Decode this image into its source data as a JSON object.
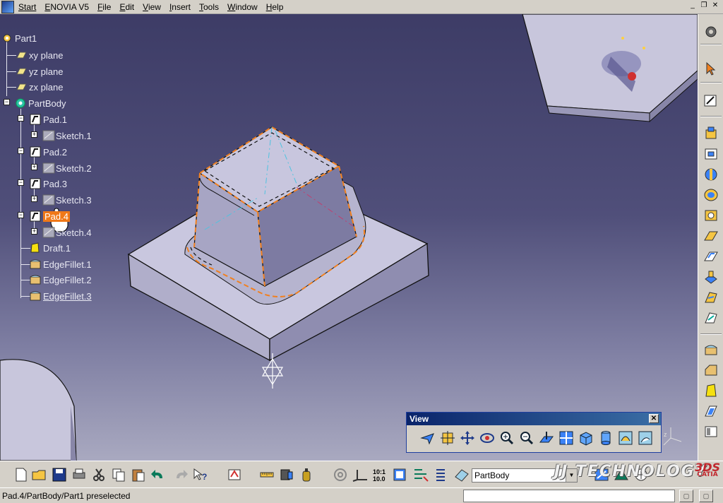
{
  "menubar": {
    "items": [
      "Start",
      "ENOVIA V5",
      "File",
      "Edit",
      "View",
      "Insert",
      "Tools",
      "Window",
      "Help"
    ]
  },
  "tree": {
    "root": "Part1",
    "items": [
      {
        "label": "xy plane",
        "icon": "plane-icon"
      },
      {
        "label": "yz plane",
        "icon": "plane-icon"
      },
      {
        "label": "zx plane",
        "icon": "plane-icon"
      },
      {
        "label": "PartBody",
        "icon": "body-gear-icon"
      },
      {
        "label": "Pad.1",
        "icon": "pad-icon"
      },
      {
        "label": "Sketch.1",
        "icon": "sketch-icon"
      },
      {
        "label": "Pad.2",
        "icon": "pad-icon"
      },
      {
        "label": "Sketch.2",
        "icon": "sketch-icon"
      },
      {
        "label": "Pad.3",
        "icon": "pad-icon"
      },
      {
        "label": "Sketch.3",
        "icon": "sketch-icon"
      },
      {
        "label": "Pad.4",
        "icon": "pad-icon"
      },
      {
        "label": "Sketch.4",
        "icon": "sketch-icon"
      },
      {
        "label": "Draft.1",
        "icon": "draft-icon"
      },
      {
        "label": "EdgeFillet.1",
        "icon": "edgefillet-icon"
      },
      {
        "label": "EdgeFillet.2",
        "icon": "edgefillet-icon"
      },
      {
        "label": "EdgeFillet.3",
        "icon": "edgefillet-icon"
      }
    ],
    "highlighted": "Pad.4"
  },
  "view_toolbar": {
    "title": "View",
    "close": "✕",
    "buttons": [
      "fly-mode-icon",
      "fit-all-icon",
      "pan-icon",
      "rotate-icon",
      "zoom-in-icon",
      "zoom-out-icon",
      "normal-view-icon",
      "multi-view-icon",
      "iso-view-icon",
      "shading-icon",
      "hide-show-icon",
      "swap-visible-icon"
    ]
  },
  "right_toolbar": {
    "buttons": [
      "compass-icon",
      "select-arrow-icon",
      "sketcher-icon",
      "pad-icon",
      "pocket-icon",
      "shaft-icon",
      "groove-icon",
      "hole-icon",
      "rib-icon",
      "slot-icon",
      "stiffener-icon",
      "loft-icon",
      "remove-loft-icon",
      "edge-fillet-icon",
      "chamfer-icon",
      "draft-icon",
      "shell-icon",
      "thickness-icon"
    ]
  },
  "bottom_toolbar": {
    "buttons": [
      "new-icon",
      "open-icon",
      "save-icon",
      "print-icon",
      "cut-icon",
      "copy-icon",
      "paste-icon",
      "undo-icon",
      "redo-icon",
      "whats-this-icon",
      "update-icon",
      "measure-icon",
      "tools-icon",
      "mass-icon",
      "spin-icon",
      "axis-icon",
      "snap-grid-icon",
      "work-plane-icon",
      "constraint-icon",
      "layer-icon",
      "geometry-icon"
    ],
    "current_body": "PartBody",
    "watermark": "JJ TECHNOLOGY",
    "brand": "CATIA",
    "brand_mark": "3DS"
  },
  "status": {
    "text": "Pad.4/PartBody/Part1 preselected",
    "input": ""
  },
  "colors": {
    "viewport_top": "#3d3c66",
    "viewport_bottom": "#a9a9c0",
    "highlight": "#f07818",
    "title_bar": "#0a246a"
  }
}
